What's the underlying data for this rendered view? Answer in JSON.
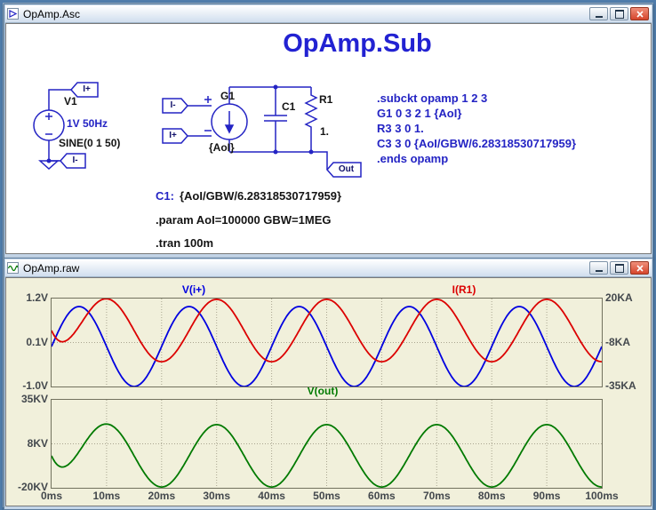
{
  "colors": {
    "heading_blue": "#2222d2",
    "schematic_blue": "#2424c4",
    "plot_background": "#f1f0db",
    "trace_blue": "#0000e0",
    "trace_red": "#dc0000",
    "trace_green": "#007a00"
  },
  "schematic_window": {
    "title": "OpAmp.Asc",
    "heading": "OpAmp.Sub",
    "components": {
      "v1_name": "V1",
      "v1_value": "1V 50Hz",
      "v1_sine": "SINE(0 1 50)",
      "g1_name": "G1",
      "g1_value": "{AoI}",
      "c1_name": "C1",
      "r1_name": "R1",
      "r1_value": "1."
    },
    "ports": {
      "in_plus": "I+",
      "in_minus": "I-",
      "out": "Out"
    },
    "netlist": [
      ".subckt opamp 1 2 3",
      "G1 0 3 2 1 {AoI}",
      "R3 3 0 1.",
      "C3 3 0 {AoI/GBW/6.28318530717959}",
      ".ends opamp"
    ],
    "directives": {
      "c1_label": "C1:",
      "c1_value": "{AoI/GBW/6.28318530717959}",
      "param": ".param AoI=100000 GBW=1MEG",
      "tran": ".tran 100m"
    }
  },
  "waveform_window": {
    "title": "OpAmp.raw"
  },
  "chart_data": [
    {
      "type": "line",
      "pane": "top",
      "x_ticks": [
        "0ms",
        "10ms",
        "20ms",
        "30ms",
        "40ms",
        "50ms",
        "60ms",
        "70ms",
        "80ms",
        "90ms",
        "100ms"
      ],
      "x_range_s": [
        0,
        0.1
      ],
      "left_axis": {
        "ticks": [
          "1.2V",
          "0.1V",
          "-1.0V"
        ],
        "range": [
          -1.0,
          1.2
        ]
      },
      "right_axis": {
        "ticks": [
          "20KA",
          "-8KA",
          "-35KA"
        ],
        "range": [
          -35000,
          20000
        ]
      },
      "series": [
        {
          "name": "V(i+)",
          "axis": "left",
          "color": "#0000e0",
          "model": "sine",
          "amplitude": 1.0,
          "frequency_hz": 50,
          "offset": 0
        },
        {
          "name": "I(R1)",
          "axis": "right",
          "color": "#dc0000",
          "model": "neg_cos_startup",
          "amplitude": 19500,
          "frequency_hz": 50,
          "startup_tau_s": 0.0025
        }
      ],
      "grid": true,
      "legend_position": "top"
    },
    {
      "type": "line",
      "pane": "bottom",
      "x_ticks": [
        "0ms",
        "10ms",
        "20ms",
        "30ms",
        "40ms",
        "50ms",
        "60ms",
        "70ms",
        "80ms",
        "90ms",
        "100ms"
      ],
      "x_range_s": [
        0,
        0.1
      ],
      "left_axis": {
        "ticks": [
          "35KV",
          "8KV",
          "-20KV"
        ],
        "range": [
          -20000,
          35000
        ]
      },
      "series": [
        {
          "name": "V(out)",
          "axis": "left",
          "color": "#007a00",
          "model": "neg_cos_startup",
          "amplitude": 19500,
          "frequency_hz": 50,
          "startup_tau_s": 0.0025
        }
      ],
      "grid": true,
      "legend_position": "top"
    }
  ]
}
